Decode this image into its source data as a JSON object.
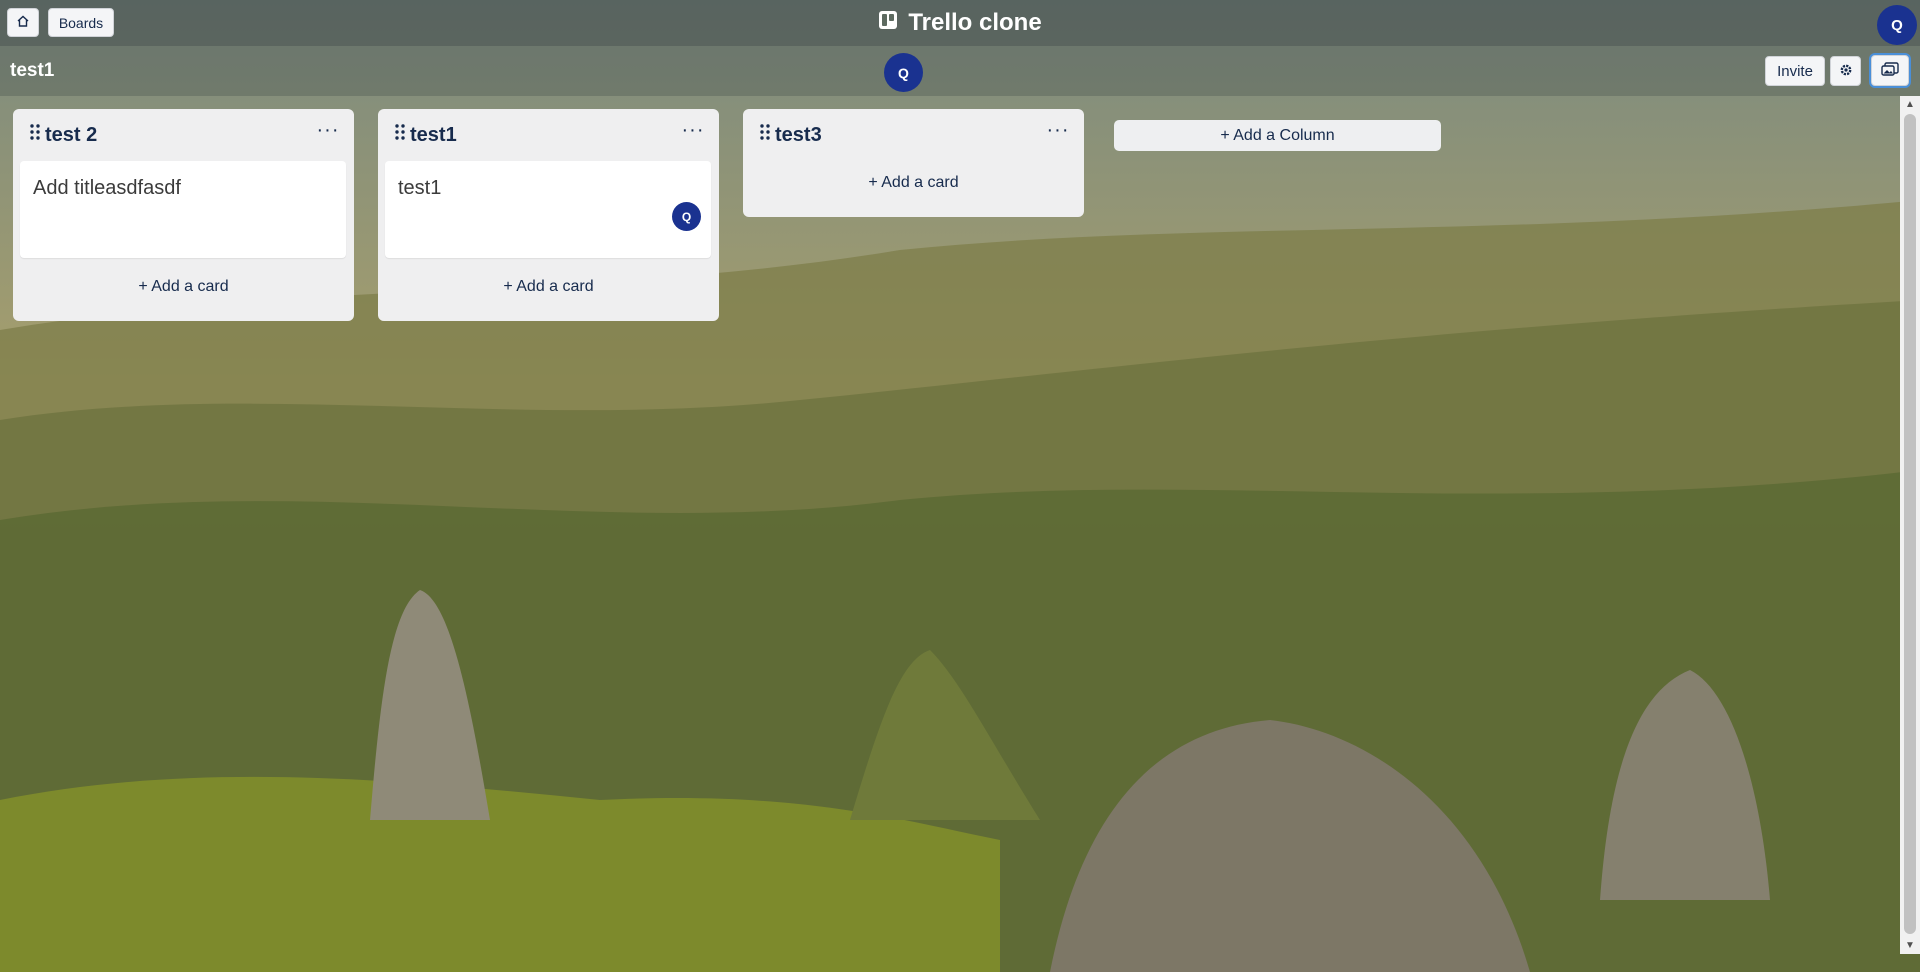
{
  "app": {
    "title": "Trello clone",
    "title_icon": "board-icon"
  },
  "topbar": {
    "home_icon": "home-icon",
    "boards_label": "Boards",
    "user_initial": "Q"
  },
  "board": {
    "title": "test1",
    "member_initial": "Q",
    "invite_label": "Invite",
    "settings_icon": "gear-icon",
    "background_icon": "image-icon"
  },
  "columns": [
    {
      "title": "test 2",
      "menu_label": "···",
      "cards": [
        {
          "text": "Add titleasdfasdf",
          "assignee_initial": ""
        }
      ],
      "add_card_label": "+ Add a card"
    },
    {
      "title": "test1",
      "menu_label": "···",
      "cards": [
        {
          "text": "test1",
          "assignee_initial": "Q"
        }
      ],
      "add_card_label": "+ Add a card"
    },
    {
      "title": "test3",
      "menu_label": "···",
      "cards": [],
      "add_card_label": "+ Add a card"
    }
  ],
  "add_column_label": "+ Add a Column",
  "colors": {
    "avatar": "#1a3290",
    "column_bg": "#efeff0",
    "text": "#172b4d"
  }
}
